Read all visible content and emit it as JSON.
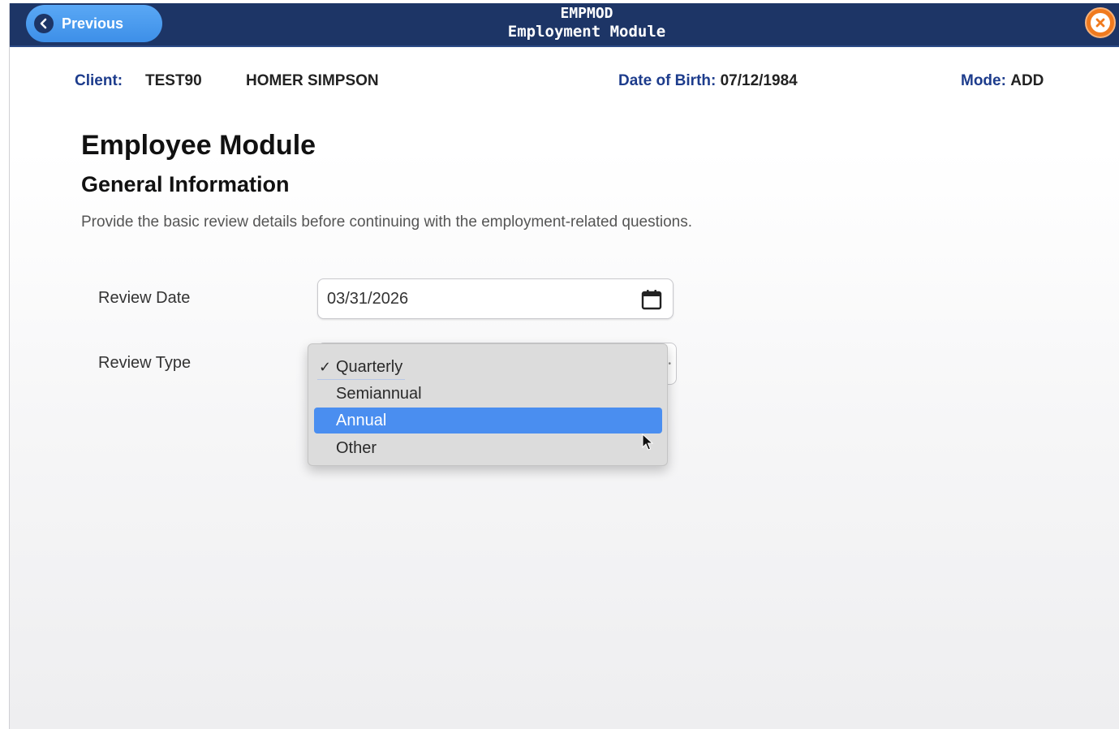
{
  "header": {
    "previous_label": "Previous",
    "module_code": "EMPMOD",
    "module_name": "Employment Module"
  },
  "client": {
    "label": "Client:",
    "id": "TEST90",
    "name": "HOMER SIMPSON",
    "dob_label": "Date of Birth:",
    "dob": "07/12/1984",
    "mode_label": "Mode:",
    "mode": "ADD"
  },
  "page": {
    "title": "Employee Module",
    "subtitle": "General Information",
    "description": "Provide the basic review details before continuing with the employment-related questions."
  },
  "form": {
    "review_date_label": "Review Date",
    "review_date_value": "03/31/2026",
    "review_type_label": "Review Type",
    "review_type_selected": "Quarterly",
    "review_type_highlighted": "Annual",
    "review_type_options": [
      "Quarterly",
      "Semiannual",
      "Annual",
      "Other"
    ]
  },
  "colors": {
    "topbar": "#1d3566",
    "previous_button": "#3d8fe8",
    "close_button": "#f07a1e",
    "label_blue": "#1d3c8c",
    "option_highlight": "#4a8ef0"
  },
  "icons": {
    "previous": "chevron-left-icon",
    "close": "close-icon",
    "calendar": "calendar-icon",
    "check": "checkmark-icon",
    "pointer": "mouse-pointer-icon"
  }
}
